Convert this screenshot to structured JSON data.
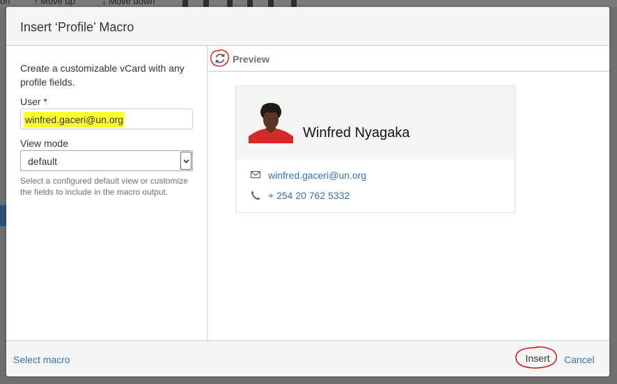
{
  "background_toolbar": {
    "item_prefix": "on",
    "move_up": "↑ Move up",
    "move_down": "↓ Move down"
  },
  "dialog": {
    "title": "Insert ‘Profile’ Macro",
    "description": "Create a customizable vCard with any profile fields.",
    "user_label": "User *",
    "user_value": "winfred.gaceri@un.org",
    "view_mode_label": "View mode",
    "view_mode_value": "default",
    "view_mode_hint": "Select a configured default view or customize the fields to include in the macro output.",
    "preview_label": "Preview",
    "profile": {
      "name": "Winfred Nyagaka",
      "email": "winfred.gaceri@un.org",
      "phone": "+ 254 20 762 5332"
    },
    "footer": {
      "select_macro": "Select macro",
      "insert": "Insert",
      "cancel": "Cancel"
    }
  },
  "colors": {
    "link": "#3572b0",
    "highlight": "#ffff2e",
    "annotation": "#e00000"
  },
  "icons": {
    "refresh": "refresh-icon",
    "email": "envelope-icon",
    "phone": "phone-icon",
    "dropdown": "chevron-down-icon"
  }
}
